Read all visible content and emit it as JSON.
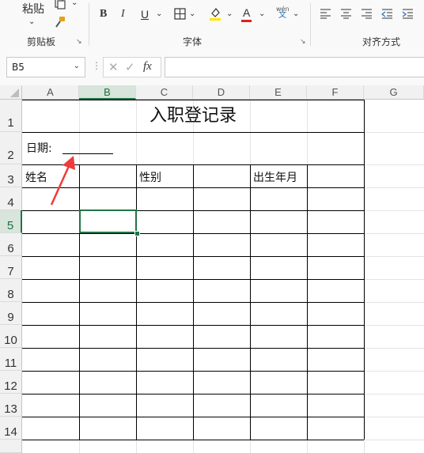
{
  "ribbon": {
    "paste_label": "粘贴",
    "clipboard_group": "剪贴板",
    "font_group": "字体",
    "alignment_group": "对齐方式",
    "bold": "B",
    "italic": "I",
    "underline": "U",
    "font_color_letter": "A",
    "phonetic_top": "wén",
    "phonetic_bottom": "文"
  },
  "formula_bar": {
    "name_box": "B5",
    "fx_label": "fx",
    "formula": ""
  },
  "sheet": {
    "columns": [
      "A",
      "B",
      "C",
      "D",
      "E",
      "F",
      "G"
    ],
    "selected_column": "B",
    "rows": [
      "1",
      "2",
      "3",
      "4",
      "5",
      "6",
      "7",
      "8",
      "9",
      "10",
      "11",
      "12",
      "13",
      "14"
    ],
    "selected_row": "5",
    "title": "入职登记录",
    "date_label": "日期:",
    "headers": {
      "name": "姓名",
      "gender": "性别",
      "birth": "出生年月"
    }
  },
  "colors": {
    "accent": "#217346",
    "annotation_arrow": "#ef3b3b"
  }
}
